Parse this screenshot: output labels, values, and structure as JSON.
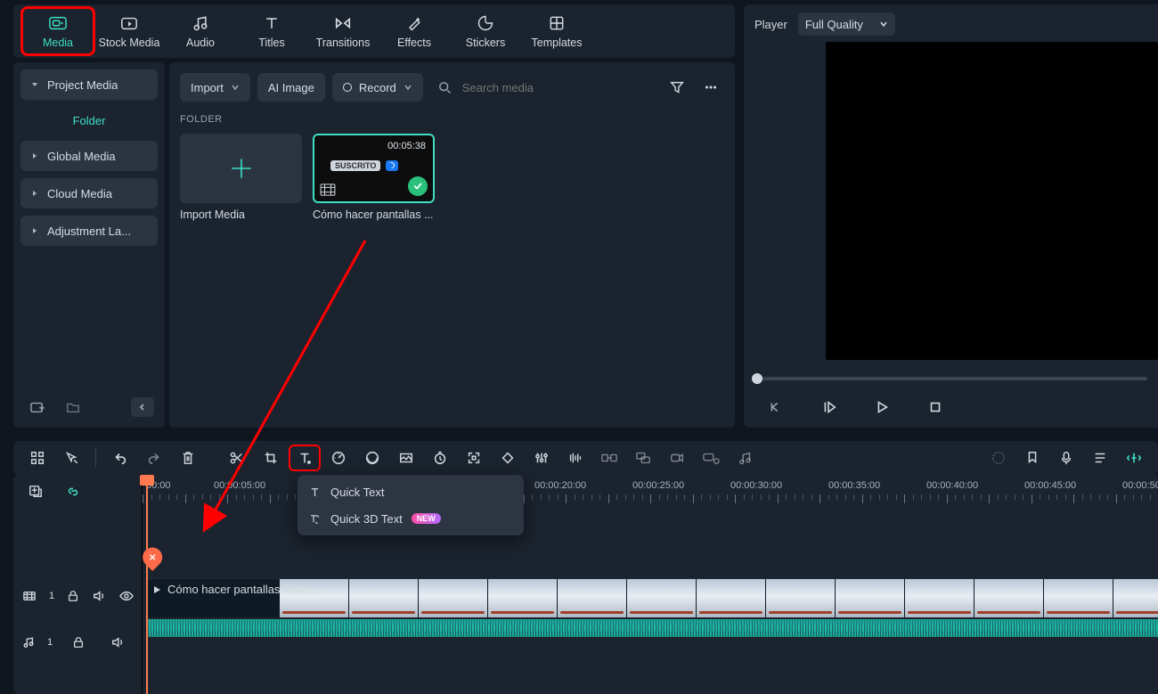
{
  "tabs": [
    {
      "id": "media",
      "label": "Media"
    },
    {
      "id": "stock",
      "label": "Stock Media"
    },
    {
      "id": "audio",
      "label": "Audio"
    },
    {
      "id": "titles",
      "label": "Titles"
    },
    {
      "id": "transitions",
      "label": "Transitions"
    },
    {
      "id": "effects",
      "label": "Effects"
    },
    {
      "id": "stickers",
      "label": "Stickers"
    },
    {
      "id": "templates",
      "label": "Templates"
    }
  ],
  "sidebar": {
    "items": [
      {
        "label": "Project Media",
        "expandable": true,
        "open": true
      },
      {
        "label": "Global Media",
        "expandable": true
      },
      {
        "label": "Cloud Media",
        "expandable": true
      },
      {
        "label": "Adjustment La...",
        "expandable": true
      }
    ],
    "folder_label": "Folder"
  },
  "toolbar2": {
    "import": "Import",
    "ai_image": "AI Image",
    "record": "Record",
    "search_placeholder": "Search media"
  },
  "media": {
    "section": "FOLDER",
    "import_caption": "Import Media",
    "clip": {
      "duration": "00:05:38",
      "badge": "SUSCRITO",
      "caption": "Cómo hacer pantallas ..."
    }
  },
  "player": {
    "title": "Player",
    "quality": "Full Quality"
  },
  "text_menu": {
    "quick_text": "Quick Text",
    "quick_3d": "Quick 3D Text",
    "new": "NEW"
  },
  "ruler_ticks": [
    "00:00",
    "00:00:05:00",
    "00:00:20:00",
    "00:00:25:00",
    "00:00:30:00",
    "00:00:35:00",
    "00:00:40:00",
    "00:00:45:00",
    "00:00:50:00"
  ],
  "ruler_positions": [
    4,
    80,
    440,
    550,
    660,
    770,
    880,
    990,
    1100
  ],
  "clip": {
    "title": "Cómo hacer pantallas finales"
  },
  "tracks": {
    "video": {
      "index": "1"
    },
    "audio": {
      "index": "1"
    }
  }
}
